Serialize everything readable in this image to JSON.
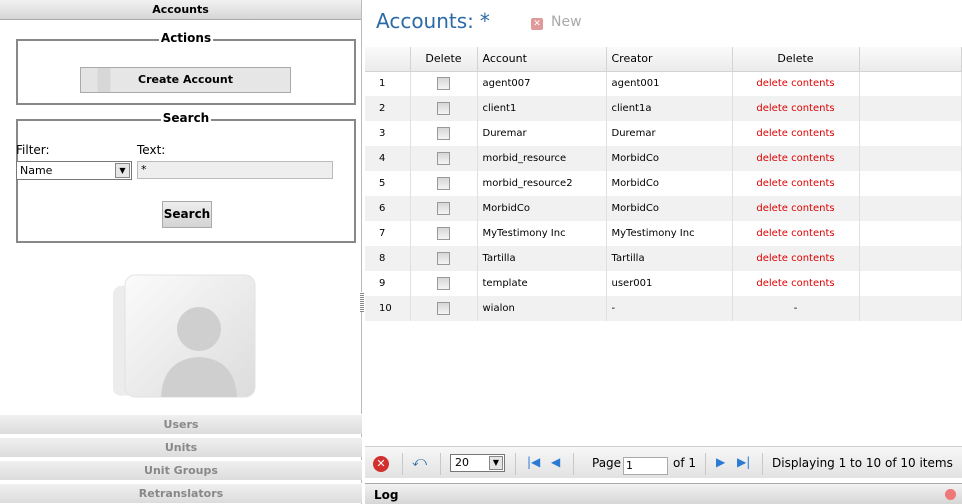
{
  "left": {
    "header": "Accounts",
    "actions_legend": "Actions",
    "create_button": "Create Account",
    "search_legend": "Search",
    "filter_label": "Filter:",
    "text_label": "Text:",
    "filter_value": "Name",
    "text_value": "*",
    "search_button": "Search",
    "nav": [
      "Users",
      "Units",
      "Unit Groups",
      "Retranslators"
    ]
  },
  "right": {
    "title": "Accounts:",
    "title_star": "*",
    "new_label": "New",
    "columns": [
      "Delete",
      "Account",
      "Creator",
      "Delete"
    ],
    "rows": [
      {
        "n": "1",
        "account": "agent007",
        "creator": "agent001",
        "action": "delete contents"
      },
      {
        "n": "2",
        "account": "client1",
        "creator": "client1a",
        "action": "delete contents"
      },
      {
        "n": "3",
        "account": "Duremar",
        "creator": "Duremar",
        "action": "delete contents"
      },
      {
        "n": "4",
        "account": "morbid_resource",
        "creator": "MorbidCo",
        "action": "delete contents"
      },
      {
        "n": "5",
        "account": "morbid_resource2",
        "creator": "MorbidCo",
        "action": "delete contents"
      },
      {
        "n": "6",
        "account": "MorbidCo",
        "creator": "MorbidCo",
        "action": "delete contents"
      },
      {
        "n": "7",
        "account": "MyTestimony Inc",
        "creator": "MyTestimony Inc",
        "action": "delete contents"
      },
      {
        "n": "8",
        "account": "Tartilla",
        "creator": "Tartilla",
        "action": "delete contents"
      },
      {
        "n": "9",
        "account": "template",
        "creator": "user001",
        "action": "delete contents"
      },
      {
        "n": "10",
        "account": "wialon",
        "creator": "-",
        "action": "-"
      }
    ],
    "pager": {
      "page_size": "20",
      "page_label": "Page",
      "page_value": "1",
      "of_label": "of 1",
      "display_text": "Displaying 1 to 10 of 10 items"
    },
    "log_label": "Log"
  },
  "colors": {
    "accent": "#2b6aa6",
    "danger": "#dd0000"
  }
}
